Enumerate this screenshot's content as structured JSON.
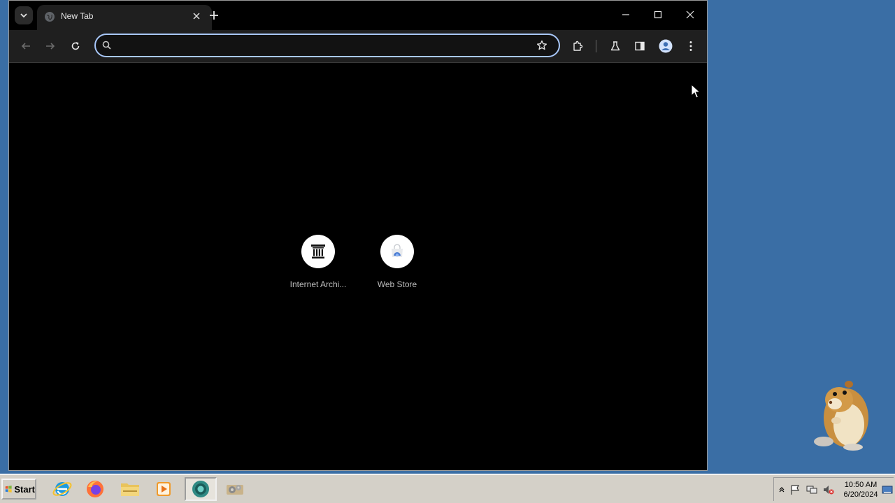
{
  "browser": {
    "tab": {
      "title": "New Tab",
      "favicon": "globe-icon"
    },
    "omnibox": {
      "value": "",
      "placeholder": ""
    },
    "shortcuts": [
      {
        "label": "Internet Archi...",
        "icon": "internet-archive-icon"
      },
      {
        "label": "Web Store",
        "icon": "web-store-icon"
      }
    ],
    "accent_color": "#a8c7fa"
  },
  "taskbar": {
    "start_label": "Start",
    "apps": [
      {
        "name": "internet-explorer"
      },
      {
        "name": "firefox"
      },
      {
        "name": "file-explorer"
      },
      {
        "name": "media-player"
      },
      {
        "name": "chrome",
        "active": true
      },
      {
        "name": "settings-tool"
      }
    ],
    "clock": {
      "time": "10:50 AM",
      "date": "6/20/2024"
    }
  },
  "colors": {
    "desktop": "#3a6ea5",
    "taskbar": "#d4d0c8"
  }
}
